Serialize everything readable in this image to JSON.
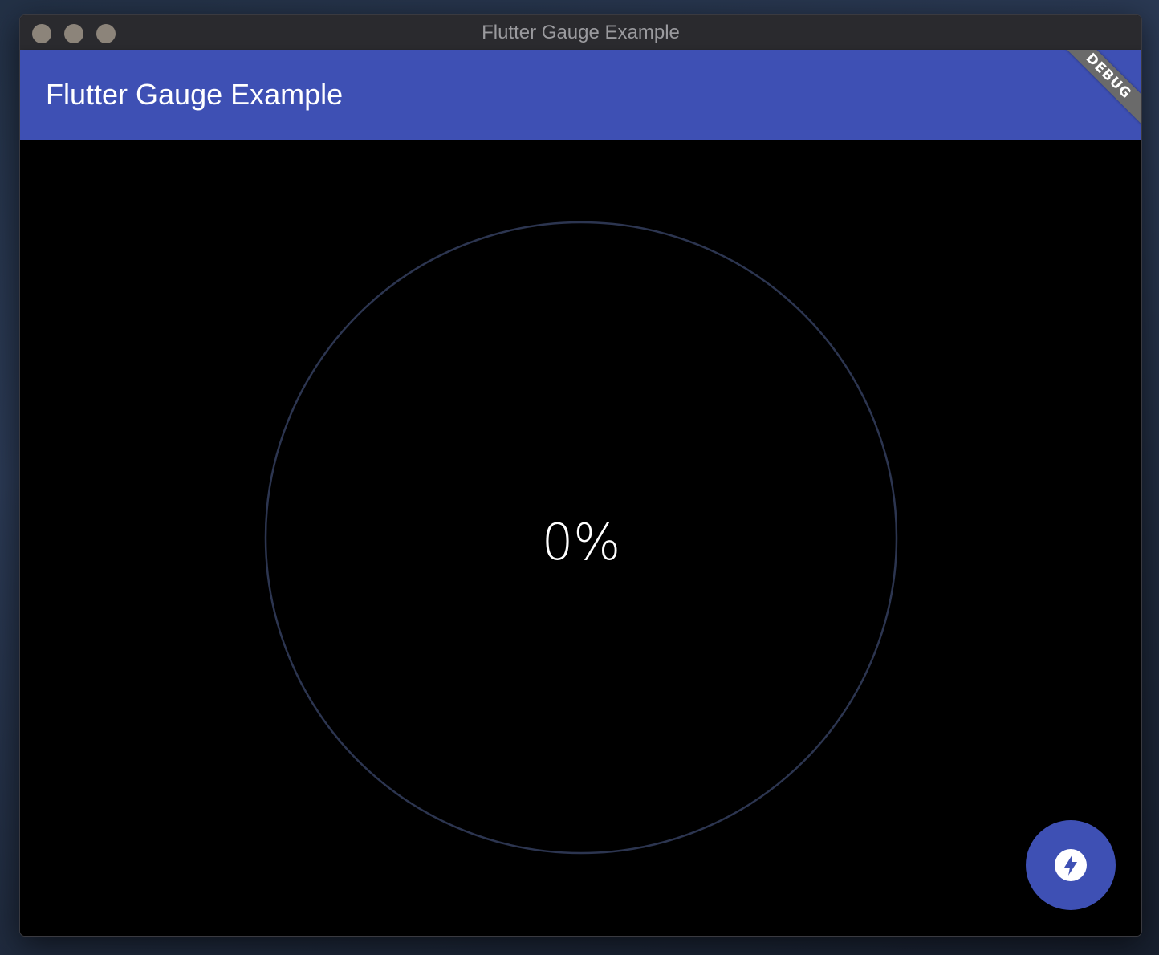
{
  "window": {
    "title": "Flutter Gauge Example",
    "traffic_lights": [
      "close",
      "minimize",
      "maximize"
    ]
  },
  "appbar": {
    "title": "Flutter Gauge Example",
    "background_color": "#3e50b4"
  },
  "debug_banner": {
    "label": "DEBUG"
  },
  "gauge": {
    "value_text": "0%",
    "value": 0,
    "track_color": "#2c3550"
  },
  "fab": {
    "icon": "flash-on-icon",
    "color": "#3e50b4"
  }
}
